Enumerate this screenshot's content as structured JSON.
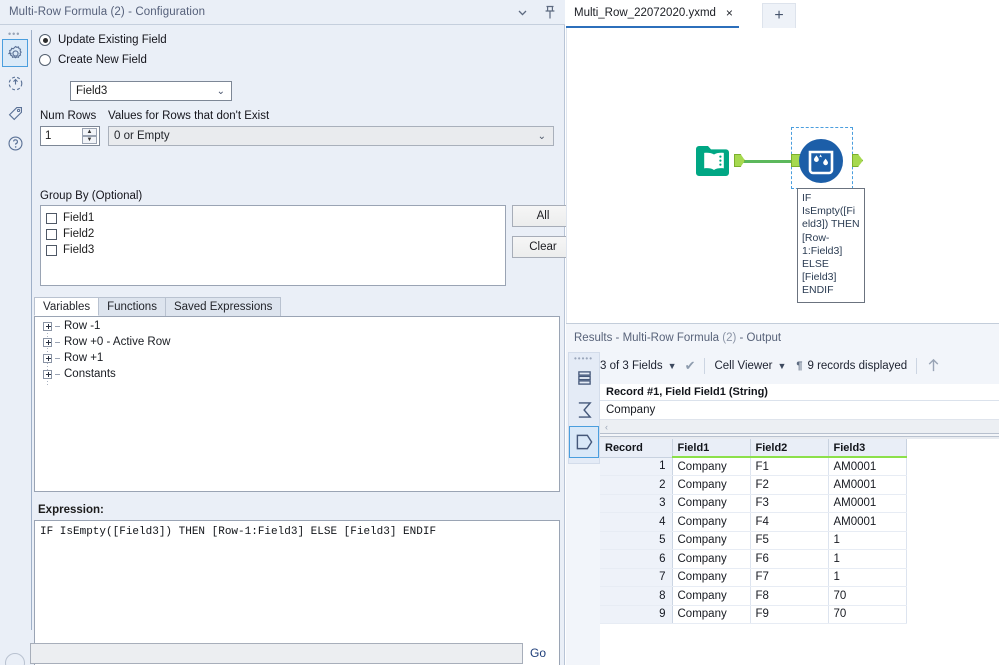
{
  "config": {
    "title": "Multi-Row Formula (2) - Configuration",
    "titlebar_icons": {
      "collapse": "chevron-down-icon",
      "pin": "pin-icon"
    },
    "strip_icons": [
      "gear-icon",
      "rotate-icon",
      "tag-icon",
      "help-icon"
    ],
    "radios": [
      {
        "label": "Update Existing Field",
        "selected": true
      },
      {
        "label": "Create New  Field",
        "selected": false
      }
    ],
    "field_select": {
      "value": "Field3"
    },
    "num_rows": {
      "label": "Num Rows",
      "value": "1"
    },
    "values_missing": {
      "label": "Values for Rows that don't Exist",
      "value": "0 or Empty"
    },
    "group_by": {
      "label": "Group By (Optional)",
      "items": [
        {
          "label": "Field1",
          "checked": false
        },
        {
          "label": "Field2",
          "checked": false
        },
        {
          "label": "Field3",
          "checked": false
        }
      ],
      "all_button": "All",
      "clear_button": "Clear"
    },
    "tabs": [
      {
        "label": "Variables",
        "active": true
      },
      {
        "label": "Functions",
        "active": false
      },
      {
        "label": "Saved Expressions",
        "active": false
      }
    ],
    "variables_tree": [
      "Row -1",
      "Row +0 - Active Row",
      "Row +1",
      "Constants"
    ],
    "expression": {
      "label": "Expression:",
      "value": "IF IsEmpty([Field3]) THEN [Row-1:Field3] ELSE [Field3] ENDIF"
    },
    "bottom": {
      "search_value": "",
      "go_label": "Go"
    }
  },
  "canvas": {
    "tab": {
      "name": "Multi_Row_22072020.yxmd",
      "close": "×"
    },
    "new_tab": "+",
    "nodes": [
      {
        "name": "input-data-tool",
        "icon": "book-icon"
      },
      {
        "name": "multi-row-formula-tool",
        "icon": "water-container-icon",
        "selected": true
      }
    ],
    "annotation": "IF IsEmpty([Field3]) THEN [Row-1:Field3] ELSE [Field3] ENDIF",
    "colors": {
      "input_tool": "#00a784",
      "mrf_tool": "#1c5ea8",
      "connector": "#5cb85c",
      "port": "#a6d94f",
      "selection": "#4a9ede"
    }
  },
  "results": {
    "title_main": "Results - Multi-Row Formula",
    "title_paren": " (2) ",
    "title_tail": "- Output",
    "strip_icons": [
      "data-table-icon",
      "sigma-icon",
      "hexagon-icon"
    ],
    "toolbar": {
      "fields_label": "3 of 3 Fields",
      "check_icon": "checkmark-icon",
      "cell_viewer_label": "Cell Viewer",
      "pilcrow_icon": "pilcrow-icon",
      "records_label": "9 records displayed",
      "up_arrow_icon": "arrow-up-icon"
    },
    "cell_viewer": {
      "header": "Record #1, Field Field1 (String)",
      "value": "Company"
    },
    "grid": {
      "columns": [
        "Record",
        "Field1",
        "Field2",
        "Field3"
      ],
      "rows": [
        [
          "1",
          "Company",
          "F1",
          "AM0001"
        ],
        [
          "2",
          "Company",
          "F2",
          "AM0001"
        ],
        [
          "3",
          "Company",
          "F3",
          "AM0001"
        ],
        [
          "4",
          "Company",
          "F4",
          "AM0001"
        ],
        [
          "5",
          "Company",
          "F5",
          "1"
        ],
        [
          "6",
          "Company",
          "F6",
          "1"
        ],
        [
          "7",
          "Company",
          "F7",
          "1"
        ],
        [
          "8",
          "Company",
          "F8",
          "70"
        ],
        [
          "9",
          "Company",
          "F9",
          "70"
        ]
      ]
    }
  }
}
